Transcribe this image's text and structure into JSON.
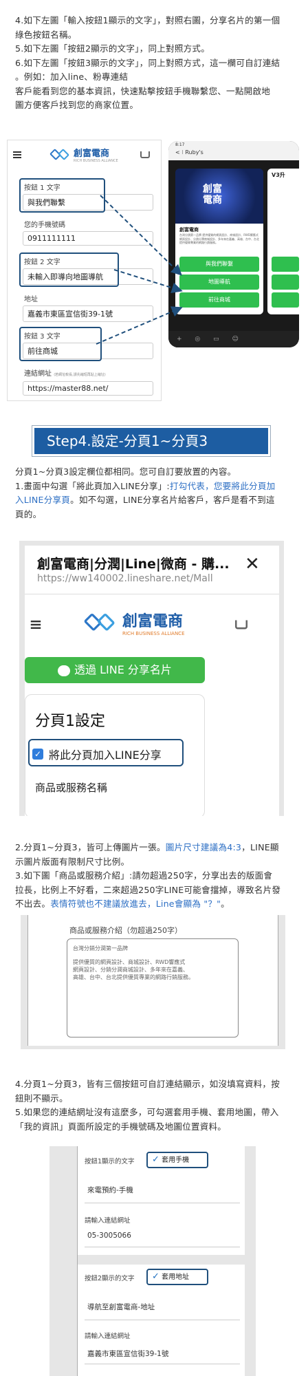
{
  "intro": {
    "line1": "4.如下左圖「輸入按鈕1顯示的文字」，對照右圖，分享名片的第一個",
    "line2": "綠色按鈕名稱。",
    "line3": "5.如下左圖「按鈕2顯示的文字」，同上對照方式。",
    "line4": "6.如下左圖「按鈕3顯示的文字」，同上對照方式，這一欄可自訂連結",
    "line5": "。例如：加入line、粉專連結",
    "line6": "客戶能看到您的基本資訊，快速點擊按鈕手機聯繫您、一點開啟地",
    "line7": "圖方便客戶找到您的商家位置。"
  },
  "form1": {
    "brand": "創富電商",
    "brand_sub": "RICH BUSINESS ALLIANCE",
    "btn1_label": "按鈕 1 文字",
    "btn1_value": "與我們聯繫",
    "phone_label": "您的手機號碼",
    "phone_value": "0911111111",
    "btn2_label": "按鈕 2 文字",
    "btn2_value": "未輸入即導向地圖導航",
    "addr_label": "地址",
    "addr_value": "嘉義市東區宣信街39-1號",
    "btn3_label": "按鈕 3 文字",
    "btn3_value": "前往商城",
    "url_label": "連結網址",
    "url_hint": "(若網址較長,請先縮短再貼上縮址)",
    "url_value": "https://master88.net/"
  },
  "phone": {
    "time": "8:17",
    "chat_title": "Ruby's",
    "card_title": "創富電商",
    "card_logo_line1": "創富",
    "card_logo_line2": "電商",
    "card_text": "台灣分銷第一品牌 提供優質的網頁設計、商城設計、RWD響應式網頁設計、分銷分潤商城設計、多年來在嘉義、高雄、台中、台北提供優質專業的網路行銷服務。",
    "side_title": "V3升",
    "btn1": "與我們聯繫",
    "btn2": "地圖導航",
    "btn3": "前往商城"
  },
  "step4": {
    "heading": "Step4.設定-分頁1~分頁3",
    "p1": "分頁1~分頁3設定欄位都相同。您可自訂要放置的內容。",
    "p2a": "1.畫面中勾選「將此頁加入LINE分享」:",
    "p2b": "打勾代表，您要將此分頁加",
    "p2c": "入LINE分享頁",
    "p2d": "。如不勾選，LINE分享名片給客戶，客戶是看不到這",
    "p2e": "頁的。"
  },
  "browser": {
    "title": "創富電商|分潤|Line|微商 - 購...",
    "url": "https://ww140002.lineshare.net/Mall",
    "share_btn": "透過 LINE 分享名片",
    "section_title": "分頁1設定",
    "checkbox_label": "將此分頁加入LINE分享",
    "field_label": "商品或服務名稱"
  },
  "mid": {
    "l1a": "2.分頁1~分頁3，皆可上傳圖片一張。",
    "l1b": "圖片尺寸建議為4:3",
    "l1c": "，LINE顯",
    "l2": "示圖片版面有限制尺寸比例。",
    "l3": "3.如下圖「商品或服務介紹」:請勿超過250字，分享出去的版面會",
    "l4": "拉長，比例上不好看，二來超過250字LINE可能會擋掉，導致名片發",
    "l5a": "不出去。",
    "l5b": "表情符號也不建議放進去，Line會顯為 \"？\"",
    "l5c": "。"
  },
  "intro_box": {
    "label": "商品或服務介紹（勿超過250字）",
    "t1": "台灣分銷分潤第一品牌",
    "t2": "提供優質的網頁設計、商城設計、RWD響應式",
    "t3": "網頁設計、分銷分潤商城設計、多年來在嘉義、",
    "t4": "高雄、台中、台北提供優質專業的網路行銷服務。"
  },
  "bottom": {
    "l1": "4.分頁1~分頁3，皆有三個按鈕可自訂連結顯示，如沒填寫資料，按",
    "l2": "鈕則不顯示。",
    "l3": "5.如果您的連結網址沒有這麼多，可勾選套用手機、套用地圖，帶入",
    "l4": "「我的資訊」頁面所設定的手機號碼及地圖位置資料。"
  },
  "links": {
    "b1_label": "按鈕1顯示的文字",
    "b1_check": "套用手機",
    "b1_value": "來電預約-手機",
    "url1_label": "請輸入連結網址",
    "url1_value": "05-3005066",
    "b2_label": "按鈕2顯示的文字",
    "b2_check": "套用地址",
    "b2_value": "導航至創富電商-地址",
    "url2_label": "請輸入連結網址",
    "url2_value": "嘉義市東區宣信街39-1號"
  }
}
